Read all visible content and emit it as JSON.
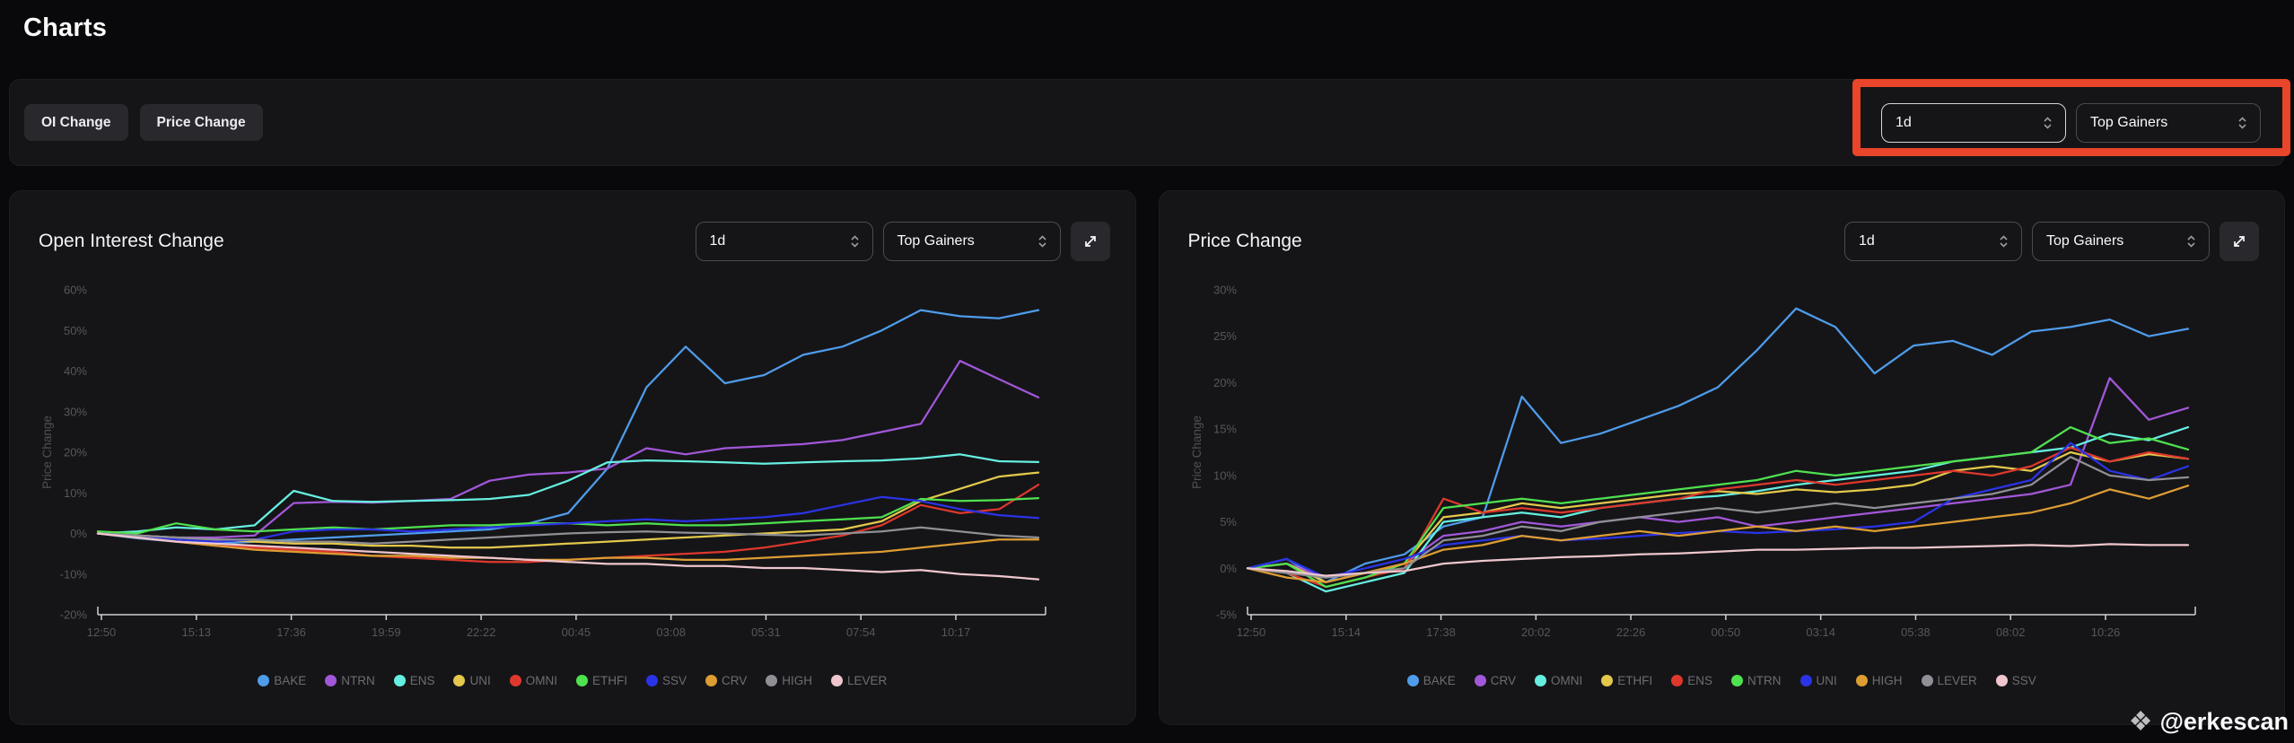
{
  "page": {
    "title": "Charts",
    "watermark_handle": "@erkescan"
  },
  "toolbar": {
    "tabs": [
      {
        "label": "OI Change"
      },
      {
        "label": "Price Change"
      }
    ],
    "timeframe_value": "1d",
    "ranking_value": "Top Gainers",
    "annotation_color": "#e8452a"
  },
  "panels": [
    {
      "title": "Open Interest Change",
      "timeframe_value": "1d",
      "ranking_value": "Top Gainers"
    },
    {
      "title": "Price Change",
      "timeframe_value": "1d",
      "ranking_value": "Top Gainers"
    }
  ],
  "chart_data": [
    {
      "type": "line",
      "title": "Open Interest Change",
      "xlabel": "",
      "ylabel": "Price Change",
      "ylim": [
        -20,
        60
      ],
      "yticks": [
        60,
        50,
        40,
        30,
        20,
        10,
        0,
        -10,
        -20
      ],
      "ytick_suffix": "%",
      "grid": false,
      "legend_position": "bottom",
      "x_ticklabels": [
        "12:50",
        "15:13",
        "17:36",
        "19:59",
        "22:22",
        "00:45",
        "03:08",
        "05:31",
        "07:54",
        "10:17"
      ],
      "series": [
        {
          "name": "BAKE",
          "color": "#4f9cea",
          "values": [
            0,
            -1.2,
            -2,
            -2.5,
            -2,
            -1.5,
            -1,
            -0.5,
            0,
            0.5,
            1,
            2.5,
            5,
            16,
            36,
            46,
            37,
            39,
            44,
            46,
            50,
            55,
            53.5,
            53,
            55
          ]
        },
        {
          "name": "NTRN",
          "color": "#a257d8",
          "values": [
            0,
            -0.5,
            -1,
            -1,
            -0.5,
            7.5,
            7.8,
            7.6,
            8,
            8.5,
            13,
            14.5,
            15,
            16,
            21,
            19.5,
            21,
            21.5,
            22,
            23,
            25,
            27,
            42.5,
            38,
            33.5
          ]
        },
        {
          "name": "ENS",
          "color": "#66efe0",
          "values": [
            0,
            0.5,
            1.5,
            1,
            2,
            10.5,
            8,
            7.8,
            8,
            8.2,
            8.5,
            9.5,
            13,
            17.5,
            18,
            17.8,
            17.5,
            17.2,
            17.5,
            17.8,
            18,
            18.5,
            19.5,
            17.8,
            17.6
          ]
        },
        {
          "name": "UNI",
          "color": "#e3c84b",
          "values": [
            0,
            -0.5,
            -1,
            -1.5,
            -2,
            -2.5,
            -2.5,
            -3,
            -3,
            -3.5,
            -3.5,
            -3,
            -2.5,
            -2,
            -1.5,
            -1,
            -0.5,
            0,
            0.5,
            1,
            3,
            8,
            11,
            14,
            15
          ]
        },
        {
          "name": "OMNI",
          "color": "#de382c",
          "values": [
            0.5,
            -1,
            -2,
            -3,
            -3.5,
            -4,
            -4.5,
            -5.5,
            -6,
            -6.5,
            -7,
            -7,
            -6.5,
            -6,
            -5.5,
            -5,
            -4.5,
            -3.5,
            -2,
            -0.5,
            2,
            7,
            5,
            6,
            12
          ]
        },
        {
          "name": "ETHFI",
          "color": "#4fe14f",
          "values": [
            0.5,
            0,
            2.5,
            1,
            0.5,
            1,
            1.5,
            1,
            1.5,
            2,
            2,
            2.5,
            2.5,
            2,
            2.5,
            2,
            2,
            2.5,
            3,
            3.5,
            4,
            8.5,
            8,
            8.2,
            8.7
          ]
        },
        {
          "name": "SSV",
          "color": "#2b33e6",
          "values": [
            0,
            -0.5,
            -1.5,
            -2,
            -1.5,
            0.5,
            1,
            1,
            0.5,
            1,
            1.5,
            2,
            2.5,
            3,
            3.5,
            3,
            3.5,
            4,
            5,
            7,
            9,
            8,
            6,
            4.5,
            3.8
          ]
        },
        {
          "name": "CRV",
          "color": "#dd9d33",
          "values": [
            0,
            -1,
            -2,
            -3,
            -4,
            -4.5,
            -5,
            -5.5,
            -5.5,
            -6,
            -6,
            -6.5,
            -6.5,
            -6,
            -6,
            -6.5,
            -6.5,
            -6,
            -5.5,
            -5,
            -4.5,
            -3.5,
            -2.5,
            -1.5,
            -1.5
          ]
        },
        {
          "name": "HIGH",
          "color": "#8f8f95",
          "values": [
            0,
            -0.5,
            -1,
            -1.5,
            -1.5,
            -2,
            -2,
            -2.5,
            -2,
            -1.5,
            -1,
            -0.5,
            0,
            0.3,
            0.5,
            0.2,
            0,
            -0.3,
            -0.5,
            0,
            0.5,
            1.5,
            0.5,
            -0.5,
            -1
          ]
        },
        {
          "name": "LEVER",
          "color": "#efc6ce",
          "values": [
            0,
            -1,
            -2,
            -2.5,
            -3,
            -3.5,
            -4,
            -4.5,
            -5,
            -5.5,
            -6,
            -6.5,
            -7,
            -7.5,
            -7.5,
            -8,
            -8,
            -8.5,
            -8.5,
            -9,
            -9.5,
            -9,
            -10,
            -10.5,
            -11.3
          ]
        }
      ]
    },
    {
      "type": "line",
      "title": "Price Change",
      "xlabel": "",
      "ylabel": "Price Change",
      "ylim": [
        -5,
        30
      ],
      "yticks": [
        30,
        25,
        20,
        15,
        10,
        5,
        0,
        -5
      ],
      "ytick_suffix": "%",
      "grid": false,
      "legend_position": "bottom",
      "x_ticklabels": [
        "12:50",
        "15:14",
        "17:38",
        "20:02",
        "22:26",
        "00:50",
        "03:14",
        "05:38",
        "08:02",
        "10:26"
      ],
      "series": [
        {
          "name": "BAKE",
          "color": "#4f9cea",
          "values": [
            0,
            1,
            -1.5,
            0.5,
            1.5,
            4.5,
            5.5,
            18.5,
            13.5,
            14.5,
            16,
            17.5,
            19.5,
            23.5,
            28,
            26,
            21,
            24,
            24.5,
            23,
            25.5,
            26,
            26.8,
            25,
            25.8
          ]
        },
        {
          "name": "CRV",
          "color": "#a257d8",
          "values": [
            0,
            0.5,
            -1,
            -0.5,
            0.5,
            3.5,
            4,
            5,
            4.5,
            5,
            5.5,
            5,
            5.5,
            4.5,
            5,
            5.5,
            6,
            6.5,
            7,
            7.5,
            8,
            9,
            20.5,
            16,
            17.3
          ]
        },
        {
          "name": "OMNI",
          "color": "#66efe0",
          "values": [
            0,
            -0.5,
            -2.5,
            -1.5,
            -0.5,
            5,
            5.5,
            6,
            5.5,
            6.5,
            7,
            7.5,
            7.8,
            8.3,
            9,
            9.5,
            10,
            10.5,
            11.5,
            12,
            12.5,
            13,
            14.5,
            13.8,
            15.2
          ]
        },
        {
          "name": "ETHFI",
          "color": "#e3c84b",
          "values": [
            0,
            0.5,
            -1.5,
            -0.5,
            0.5,
            5.5,
            6,
            7,
            6.5,
            7,
            7.5,
            8,
            8.3,
            8,
            8.5,
            8.2,
            8.5,
            9,
            10.5,
            11,
            10.5,
            12.5,
            11.5,
            12.3,
            11.8
          ]
        },
        {
          "name": "ENS",
          "color": "#de382c",
          "values": [
            0,
            -0.5,
            -2,
            -1,
            0,
            7.5,
            6,
            6.5,
            6,
            6.5,
            7,
            7.5,
            8.5,
            9,
            9.5,
            9,
            9.5,
            10,
            10.5,
            10,
            11,
            13,
            11.5,
            12.5,
            11.8
          ]
        },
        {
          "name": "NTRN",
          "color": "#4fe14f",
          "values": [
            0,
            0.5,
            -2,
            -1,
            0.5,
            6.5,
            7,
            7.5,
            7,
            7.5,
            8,
            8.5,
            9,
            9.5,
            10.5,
            10,
            10.5,
            11,
            11.5,
            12,
            12.5,
            15.2,
            13.5,
            14,
            12.8
          ]
        },
        {
          "name": "UNI",
          "color": "#2b33e6",
          "values": [
            0,
            1,
            -1,
            0,
            1,
            2.5,
            3,
            3.5,
            3,
            3.2,
            3.5,
            3.8,
            4,
            3.8,
            4,
            4.2,
            4.5,
            5,
            7.5,
            8.5,
            9.5,
            13.5,
            10.5,
            9.5,
            11
          ]
        },
        {
          "name": "HIGH",
          "color": "#dd9d33",
          "values": [
            0,
            -1,
            -1.5,
            -0.5,
            0.5,
            2,
            2.5,
            3.5,
            3,
            3.5,
            4,
            3.5,
            4,
            4.5,
            4,
            4.5,
            4,
            4.5,
            5,
            5.5,
            6,
            7,
            8.5,
            7.5,
            8.9
          ]
        },
        {
          "name": "LEVER",
          "color": "#8f8f95",
          "values": [
            0,
            -0.5,
            -1,
            -0.5,
            0,
            3,
            3.5,
            4.5,
            4,
            5,
            5.5,
            6,
            6.5,
            6,
            6.5,
            7,
            6.5,
            7,
            7.5,
            8,
            9,
            12,
            10,
            9.5,
            9.8
          ]
        },
        {
          "name": "SSV",
          "color": "#efc6ce",
          "values": [
            0,
            -0.3,
            -0.8,
            -0.5,
            -0.3,
            0.5,
            0.8,
            1,
            1.2,
            1.3,
            1.5,
            1.6,
            1.8,
            2,
            2,
            2.1,
            2.2,
            2.2,
            2.3,
            2.4,
            2.5,
            2.4,
            2.6,
            2.5,
            2.5
          ]
        }
      ]
    }
  ]
}
